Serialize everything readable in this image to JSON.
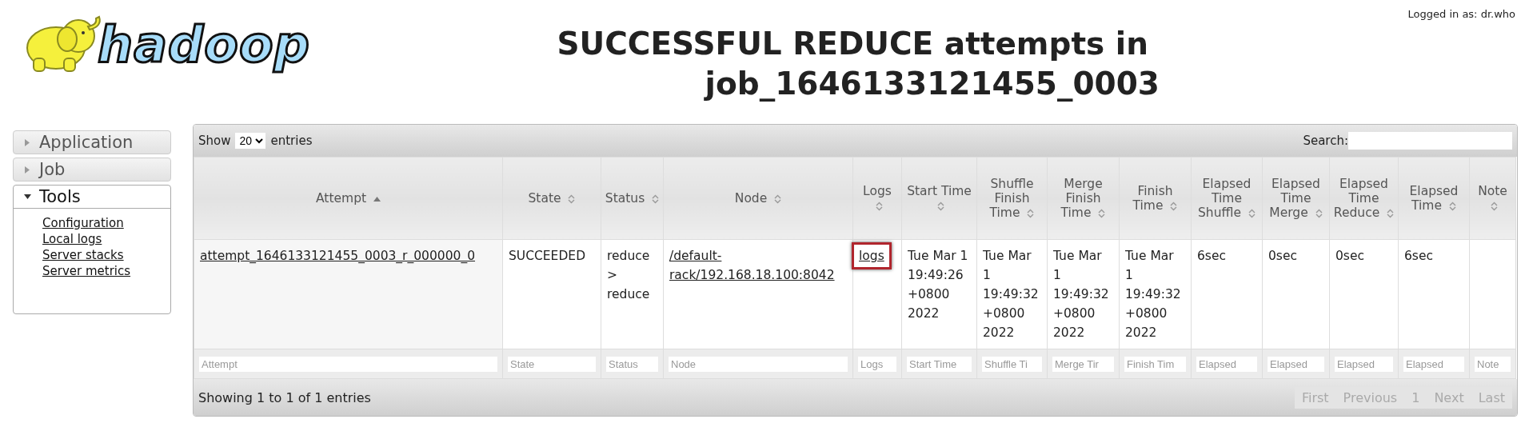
{
  "logo": {
    "text": "hadoop"
  },
  "title": {
    "line_1": "SUCCESSFUL REDUCE attempts in",
    "line_2": "job_1646133121455_0003"
  },
  "user": "Logged in as: dr.who",
  "sidebar": {
    "items": [
      {
        "label": "Application",
        "expanded": false
      },
      {
        "label": "Job",
        "expanded": false
      },
      {
        "label": "Tools",
        "expanded": true,
        "children": [
          {
            "label": "Configuration"
          },
          {
            "label": "Local logs"
          },
          {
            "label": "Server stacks"
          },
          {
            "label": "Server metrics"
          }
        ]
      }
    ]
  },
  "table": {
    "show_label": "Show",
    "page_size": "20",
    "entries_label": "entries",
    "search_label": "Search:",
    "columns": [
      {
        "label": "Attempt",
        "sorted": true
      },
      {
        "label": "State",
        "sorted": false
      },
      {
        "label": "Status",
        "sorted": false
      },
      {
        "label": "Node",
        "sorted": false
      },
      {
        "label": "Logs",
        "sorted": false
      },
      {
        "label": "Start Time",
        "sorted": false
      },
      {
        "label": "Shuffle Finish Time",
        "sorted": false
      },
      {
        "label": "Merge Finish Time",
        "sorted": false
      },
      {
        "label": "Finish Time",
        "sorted": false
      },
      {
        "label": "Elapsed Time Shuffle",
        "sorted": false
      },
      {
        "label": "Elapsed Time Merge",
        "sorted": false
      },
      {
        "label": "Elapsed Time Reduce",
        "sorted": false
      },
      {
        "label": "Elapsed Time",
        "sorted": false
      },
      {
        "label": "Note",
        "sorted": false
      }
    ],
    "rows": [
      {
        "cells": [
          {
            "text": "attempt_1646133121455_0003_r_000000_0",
            "kind": "link"
          },
          {
            "text": "SUCCEEDED",
            "kind": "text"
          },
          {
            "text": "reduce > reduce",
            "kind": "text"
          },
          {
            "text": "/default-rack/192.168.18.100:8042",
            "kind": "link"
          },
          {
            "text": "logs",
            "kind": "link",
            "highlighted": true
          },
          {
            "text": "Tue Mar 1 19:49:26 +0800 2022",
            "kind": "text"
          },
          {
            "text": "Tue Mar 1 19:49:32 +0800 2022",
            "kind": "text"
          },
          {
            "text": "Tue Mar 1 19:49:32 +0800 2022",
            "kind": "text"
          },
          {
            "text": "Tue Mar 1 19:49:32 +0800 2022",
            "kind": "text"
          },
          {
            "text": "6sec",
            "kind": "text"
          },
          {
            "text": "0sec",
            "kind": "text"
          },
          {
            "text": "0sec",
            "kind": "text"
          },
          {
            "text": "6sec",
            "kind": "text"
          }
        ]
      }
    ],
    "filters": [
      {
        "placeholder": "Attempt"
      },
      {
        "placeholder": "State"
      },
      {
        "placeholder": "Status"
      },
      {
        "placeholder": "Node"
      },
      {
        "placeholder": "Logs"
      },
      {
        "placeholder": "Start Time"
      },
      {
        "placeholder": "Shuffle Ti"
      },
      {
        "placeholder": "Merge Tir"
      },
      {
        "placeholder": "Finish Tim"
      },
      {
        "placeholder": "Elapsed"
      },
      {
        "placeholder": "Elapsed"
      },
      {
        "placeholder": "Elapsed"
      },
      {
        "placeholder": "Elapsed"
      },
      {
        "placeholder": "Note"
      }
    ],
    "info": "Showing 1 to 1 of 1 entries",
    "pagination": [
      {
        "label": "First",
        "disabled": true
      },
      {
        "label": "Previous",
        "disabled": true
      },
      {
        "label": "1",
        "disabled": true
      },
      {
        "label": "Next",
        "disabled": true
      },
      {
        "label": "Last",
        "disabled": true
      }
    ]
  }
}
